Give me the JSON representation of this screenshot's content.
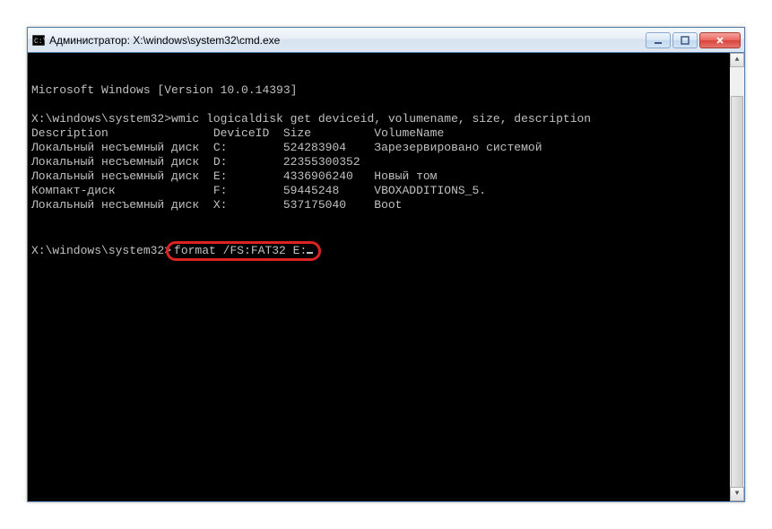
{
  "window": {
    "title": "Администратор: X:\\windows\\system32\\cmd.exe"
  },
  "terminal": {
    "line1": "Microsoft Windows [Version 10.0.14393]",
    "blank": "",
    "prompt1": "X:\\windows\\system32>",
    "cmd1": "wmic logicaldisk get deviceid, volumename, size, description",
    "header": "Description               DeviceID  Size         VolumeName",
    "row1": "Локальный несъемный диск  C:        524283904    Зарезервировано системой",
    "row2": "Локальный несъемный диск  D:        22355300352",
    "row3": "Локальный несъемный диск  E:        4336906240   Новый том",
    "row4": "Компакт-диск              F:        59445248     VBOXADDITIONS_5.",
    "row5": "Локальный несъемный диск  X:        537175040    Boot",
    "prompt2": "X:\\windows\\system32>",
    "cmd2": "format /FS:FAT32 E:"
  }
}
